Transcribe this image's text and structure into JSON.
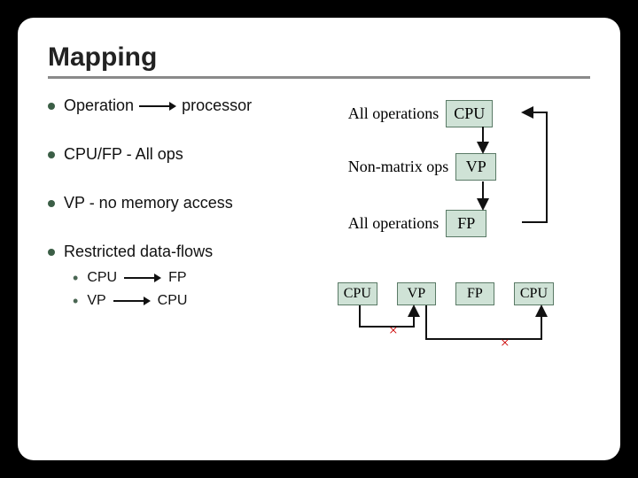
{
  "title": "Mapping",
  "bullets": {
    "b1a": "Operation",
    "b1b": "processor",
    "b2": "CPU/FP - All ops",
    "b3": "VP - no memory access",
    "b4": "Restricted data-flows",
    "s1a": "CPU",
    "s1b": "FP",
    "s2a": "VP",
    "s2b": "CPU"
  },
  "diagram": {
    "l1": "All operations",
    "l2": "Non-matrix ops",
    "l3": "All operations",
    "box1": "CPU",
    "box2": "VP",
    "box3": "FP",
    "flow1": "CPU",
    "flow2": "VP",
    "flow3": "FP",
    "flow4": "CPU",
    "xmark": "×"
  }
}
